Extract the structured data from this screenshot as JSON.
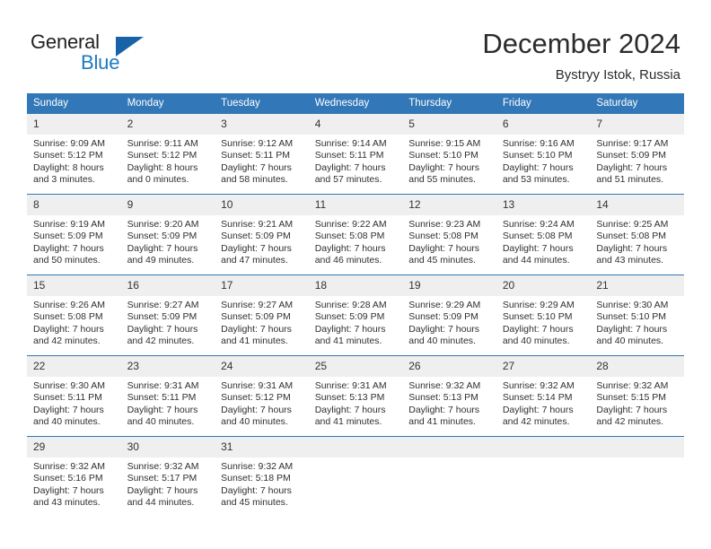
{
  "brand": {
    "name_part1": "General",
    "name_part2": "Blue",
    "triangle_icon": "triangle-icon",
    "accent_color": "#1b7ac2"
  },
  "header": {
    "title": "December 2024",
    "subtitle": "Bystryy Istok, Russia"
  },
  "theme": {
    "header_blue": "#3277b7",
    "daynum_band": "#efefef",
    "text": "#2f2f2f"
  },
  "weekday_headers": [
    "Sunday",
    "Monday",
    "Tuesday",
    "Wednesday",
    "Thursday",
    "Friday",
    "Saturday"
  ],
  "weeks": [
    [
      {
        "day": "1",
        "sunrise": "Sunrise: 9:09 AM",
        "sunset": "Sunset: 5:12 PM",
        "daylight1": "Daylight: 8 hours",
        "daylight2": "and 3 minutes."
      },
      {
        "day": "2",
        "sunrise": "Sunrise: 9:11 AM",
        "sunset": "Sunset: 5:12 PM",
        "daylight1": "Daylight: 8 hours",
        "daylight2": "and 0 minutes."
      },
      {
        "day": "3",
        "sunrise": "Sunrise: 9:12 AM",
        "sunset": "Sunset: 5:11 PM",
        "daylight1": "Daylight: 7 hours",
        "daylight2": "and 58 minutes."
      },
      {
        "day": "4",
        "sunrise": "Sunrise: 9:14 AM",
        "sunset": "Sunset: 5:11 PM",
        "daylight1": "Daylight: 7 hours",
        "daylight2": "and 57 minutes."
      },
      {
        "day": "5",
        "sunrise": "Sunrise: 9:15 AM",
        "sunset": "Sunset: 5:10 PM",
        "daylight1": "Daylight: 7 hours",
        "daylight2": "and 55 minutes."
      },
      {
        "day": "6",
        "sunrise": "Sunrise: 9:16 AM",
        "sunset": "Sunset: 5:10 PM",
        "daylight1": "Daylight: 7 hours",
        "daylight2": "and 53 minutes."
      },
      {
        "day": "7",
        "sunrise": "Sunrise: 9:17 AM",
        "sunset": "Sunset: 5:09 PM",
        "daylight1": "Daylight: 7 hours",
        "daylight2": "and 51 minutes."
      }
    ],
    [
      {
        "day": "8",
        "sunrise": "Sunrise: 9:19 AM",
        "sunset": "Sunset: 5:09 PM",
        "daylight1": "Daylight: 7 hours",
        "daylight2": "and 50 minutes."
      },
      {
        "day": "9",
        "sunrise": "Sunrise: 9:20 AM",
        "sunset": "Sunset: 5:09 PM",
        "daylight1": "Daylight: 7 hours",
        "daylight2": "and 49 minutes."
      },
      {
        "day": "10",
        "sunrise": "Sunrise: 9:21 AM",
        "sunset": "Sunset: 5:09 PM",
        "daylight1": "Daylight: 7 hours",
        "daylight2": "and 47 minutes."
      },
      {
        "day": "11",
        "sunrise": "Sunrise: 9:22 AM",
        "sunset": "Sunset: 5:08 PM",
        "daylight1": "Daylight: 7 hours",
        "daylight2": "and 46 minutes."
      },
      {
        "day": "12",
        "sunrise": "Sunrise: 9:23 AM",
        "sunset": "Sunset: 5:08 PM",
        "daylight1": "Daylight: 7 hours",
        "daylight2": "and 45 minutes."
      },
      {
        "day": "13",
        "sunrise": "Sunrise: 9:24 AM",
        "sunset": "Sunset: 5:08 PM",
        "daylight1": "Daylight: 7 hours",
        "daylight2": "and 44 minutes."
      },
      {
        "day": "14",
        "sunrise": "Sunrise: 9:25 AM",
        "sunset": "Sunset: 5:08 PM",
        "daylight1": "Daylight: 7 hours",
        "daylight2": "and 43 minutes."
      }
    ],
    [
      {
        "day": "15",
        "sunrise": "Sunrise: 9:26 AM",
        "sunset": "Sunset: 5:08 PM",
        "daylight1": "Daylight: 7 hours",
        "daylight2": "and 42 minutes."
      },
      {
        "day": "16",
        "sunrise": "Sunrise: 9:27 AM",
        "sunset": "Sunset: 5:09 PM",
        "daylight1": "Daylight: 7 hours",
        "daylight2": "and 42 minutes."
      },
      {
        "day": "17",
        "sunrise": "Sunrise: 9:27 AM",
        "sunset": "Sunset: 5:09 PM",
        "daylight1": "Daylight: 7 hours",
        "daylight2": "and 41 minutes."
      },
      {
        "day": "18",
        "sunrise": "Sunrise: 9:28 AM",
        "sunset": "Sunset: 5:09 PM",
        "daylight1": "Daylight: 7 hours",
        "daylight2": "and 41 minutes."
      },
      {
        "day": "19",
        "sunrise": "Sunrise: 9:29 AM",
        "sunset": "Sunset: 5:09 PM",
        "daylight1": "Daylight: 7 hours",
        "daylight2": "and 40 minutes."
      },
      {
        "day": "20",
        "sunrise": "Sunrise: 9:29 AM",
        "sunset": "Sunset: 5:10 PM",
        "daylight1": "Daylight: 7 hours",
        "daylight2": "and 40 minutes."
      },
      {
        "day": "21",
        "sunrise": "Sunrise: 9:30 AM",
        "sunset": "Sunset: 5:10 PM",
        "daylight1": "Daylight: 7 hours",
        "daylight2": "and 40 minutes."
      }
    ],
    [
      {
        "day": "22",
        "sunrise": "Sunrise: 9:30 AM",
        "sunset": "Sunset: 5:11 PM",
        "daylight1": "Daylight: 7 hours",
        "daylight2": "and 40 minutes."
      },
      {
        "day": "23",
        "sunrise": "Sunrise: 9:31 AM",
        "sunset": "Sunset: 5:11 PM",
        "daylight1": "Daylight: 7 hours",
        "daylight2": "and 40 minutes."
      },
      {
        "day": "24",
        "sunrise": "Sunrise: 9:31 AM",
        "sunset": "Sunset: 5:12 PM",
        "daylight1": "Daylight: 7 hours",
        "daylight2": "and 40 minutes."
      },
      {
        "day": "25",
        "sunrise": "Sunrise: 9:31 AM",
        "sunset": "Sunset: 5:13 PM",
        "daylight1": "Daylight: 7 hours",
        "daylight2": "and 41 minutes."
      },
      {
        "day": "26",
        "sunrise": "Sunrise: 9:32 AM",
        "sunset": "Sunset: 5:13 PM",
        "daylight1": "Daylight: 7 hours",
        "daylight2": "and 41 minutes."
      },
      {
        "day": "27",
        "sunrise": "Sunrise: 9:32 AM",
        "sunset": "Sunset: 5:14 PM",
        "daylight1": "Daylight: 7 hours",
        "daylight2": "and 42 minutes."
      },
      {
        "day": "28",
        "sunrise": "Sunrise: 9:32 AM",
        "sunset": "Sunset: 5:15 PM",
        "daylight1": "Daylight: 7 hours",
        "daylight2": "and 42 minutes."
      }
    ],
    [
      {
        "day": "29",
        "sunrise": "Sunrise: 9:32 AM",
        "sunset": "Sunset: 5:16 PM",
        "daylight1": "Daylight: 7 hours",
        "daylight2": "and 43 minutes."
      },
      {
        "day": "30",
        "sunrise": "Sunrise: 9:32 AM",
        "sunset": "Sunset: 5:17 PM",
        "daylight1": "Daylight: 7 hours",
        "daylight2": "and 44 minutes."
      },
      {
        "day": "31",
        "sunrise": "Sunrise: 9:32 AM",
        "sunset": "Sunset: 5:18 PM",
        "daylight1": "Daylight: 7 hours",
        "daylight2": "and 45 minutes."
      },
      {
        "day": "",
        "sunrise": "",
        "sunset": "",
        "daylight1": "",
        "daylight2": ""
      },
      {
        "day": "",
        "sunrise": "",
        "sunset": "",
        "daylight1": "",
        "daylight2": ""
      },
      {
        "day": "",
        "sunrise": "",
        "sunset": "",
        "daylight1": "",
        "daylight2": ""
      },
      {
        "day": "",
        "sunrise": "",
        "sunset": "",
        "daylight1": "",
        "daylight2": ""
      }
    ]
  ]
}
